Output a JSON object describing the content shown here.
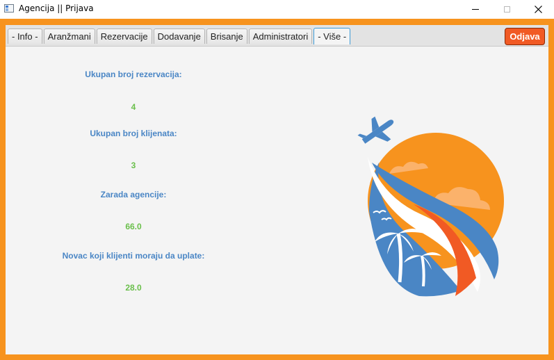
{
  "window": {
    "title": "Agencija || Prijava",
    "icon": "app-window-icon",
    "minimize_icon": "minimize-icon",
    "maximize_icon": "maximize-icon",
    "close_icon": "close-icon"
  },
  "tabs": [
    {
      "label": "- Info -"
    },
    {
      "label": "Aranžmani"
    },
    {
      "label": "Rezervacije"
    },
    {
      "label": "Dodavanje"
    },
    {
      "label": "Brisanje"
    },
    {
      "label": "Administratori"
    },
    {
      "label": "- Više -",
      "active": true
    }
  ],
  "logout_label": "Odjava",
  "stats": {
    "reservations_label": "Ukupan broj rezervacija:",
    "reservations_value": "4",
    "clients_label": "Ukupan broj klijenata:",
    "clients_value": "3",
    "earnings_label": "Zarada agencije:",
    "earnings_value": "66.0",
    "owed_label": "Novac koji klijenti moraju da uplate:",
    "owed_value": "28.0"
  },
  "logo": {
    "icon": "travel-agency-logo"
  },
  "colors": {
    "frame": "#f7931e",
    "logout_button": "#f15a24",
    "label_blue": "#4a86c5",
    "value_green": "#6abf4b",
    "active_tab_border": "#3d9bd8"
  }
}
